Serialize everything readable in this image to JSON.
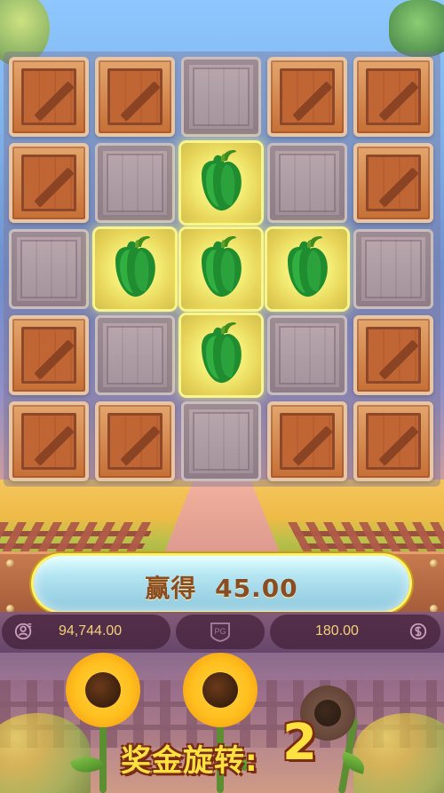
{
  "board": {
    "rows": [
      [
        "crate",
        "crate",
        "empty",
        "crate",
        "crate"
      ],
      [
        "crate",
        "empty",
        "pepper",
        "empty",
        "crate"
      ],
      [
        "empty",
        "pepper",
        "pepper",
        "pepper",
        "empty"
      ],
      [
        "crate",
        "empty",
        "pepper",
        "empty",
        "crate"
      ],
      [
        "crate",
        "crate",
        "empty",
        "crate",
        "crate"
      ]
    ]
  },
  "win": {
    "label": "赢得",
    "amount": "45.00"
  },
  "status": {
    "balance": "94,744.00",
    "logo": "PG",
    "bet": "180.00"
  },
  "bonus": {
    "label": "奖金旋转:",
    "count": "2"
  },
  "colors": {
    "accent": "#ffe13f",
    "win_text": "#8b4c1f",
    "status_text": "#f2d17b"
  }
}
